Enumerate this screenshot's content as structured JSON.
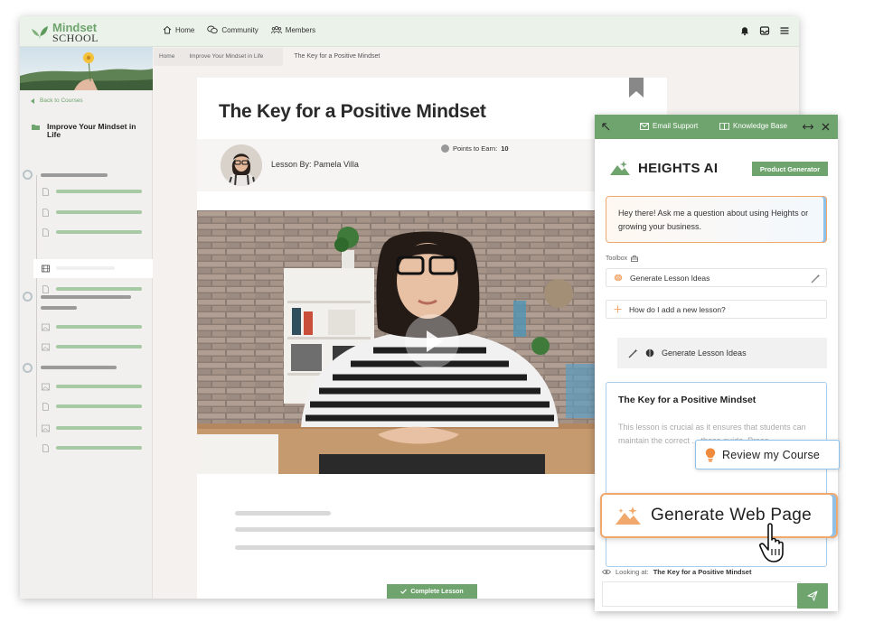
{
  "topbar": {
    "logo_line1": "Mindset",
    "logo_line2": "SCHOOL",
    "nav": [
      {
        "label": "Home",
        "icon": "home-icon"
      },
      {
        "label": "Community",
        "icon": "chat-icon"
      },
      {
        "label": "Members",
        "icon": "members-icon"
      }
    ],
    "icons": [
      "bell-icon",
      "inbox-icon",
      "menu-icon"
    ]
  },
  "sidebar": {
    "back_label": "Back to Courses",
    "course_title": "Improve Your Mindset in Life"
  },
  "breadcrumb": {
    "items": [
      "Home",
      "Improve Your Mindset in Life"
    ],
    "current": "The Key for a Positive Mindset"
  },
  "lesson": {
    "title": "The Key for a Positive Mindset",
    "author": "Lesson By: Pamela Villa",
    "points_label": "Points to Earn:",
    "points_value": "10",
    "complete_label": "Complete Lesson"
  },
  "ai_panel": {
    "header": {
      "email_support": "Email Support",
      "knowledge_base": "Knowledge Base"
    },
    "brand": "HEIGHTS AI",
    "badge": "Product Generator",
    "greeting": "Hey there! Ask me a question about using Heights or growing your business.",
    "toolbox_label": "Toolbox",
    "tool_rows": [
      "Generate Lesson Ideas",
      "How do I add a new lesson?"
    ],
    "generate_button": "Generate Lesson Ideas",
    "result": {
      "title": "The Key for a Positive Mindset",
      "text": "This lesson is crucial as it ensures that students can maintain the correct ... these guide. Proce..."
    },
    "looking_at_label": "Looking at:",
    "looking_at_value": "The Key for a Positive Mindset",
    "input_placeholder": ""
  },
  "callouts": {
    "review": "Review my Course",
    "generate_web": "Generate Web Page"
  },
  "colors": {
    "accent": "#6fa46e",
    "orange": "#f0a86d",
    "blue": "#8ec0e8"
  }
}
